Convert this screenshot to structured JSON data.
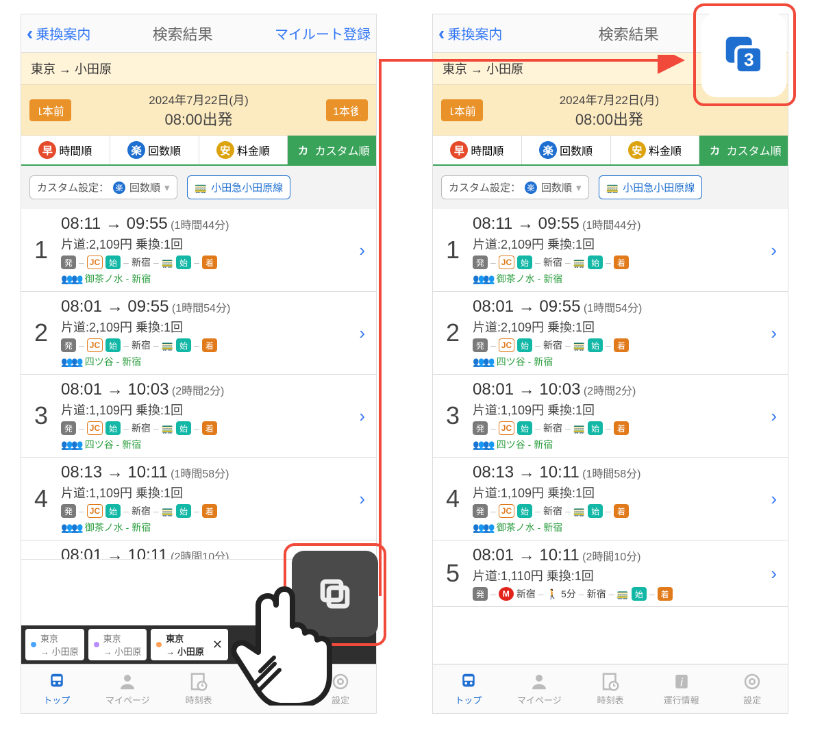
{
  "nav": {
    "back": "乗換案内",
    "title": "検索結果",
    "right": "マイルート登録"
  },
  "stations": "東京 → 小田原",
  "date": {
    "line1": "2024年7月22日(月)",
    "line2": "08:00出発",
    "prev": "1本前",
    "next": "1本後"
  },
  "sort": {
    "hayai": "時間順",
    "raku": "回数順",
    "yasui": "料金順",
    "custom": "カスタム順",
    "icon_hayai": "早",
    "icon_raku": "楽",
    "icon_yasui": "安",
    "icon_custom": "カ"
  },
  "filter": {
    "label": "カスタム設定：",
    "value": "回数順",
    "route": "小田急小田原線"
  },
  "seg": {
    "dep": "発",
    "jc": "JC",
    "start": "始",
    "station1": "新宿",
    "arr": "着",
    "walk": "5分"
  },
  "results": [
    {
      "n": "1",
      "t1": "08:11",
      "t2": "09:55",
      "dur": "(1時間44分)",
      "fare": "片道:2,109円 乗換:1回",
      "crowd": "御茶ノ水 - 新宿"
    },
    {
      "n": "2",
      "t1": "08:01",
      "t2": "09:55",
      "dur": "(1時間54分)",
      "fare": "片道:2,109円 乗換:1回",
      "crowd": "四ツ谷 - 新宿"
    },
    {
      "n": "3",
      "t1": "08:01",
      "t2": "10:03",
      "dur": "(2時間2分)",
      "fare": "片道:1,109円 乗換:1回",
      "crowd": "四ツ谷 - 新宿"
    },
    {
      "n": "4",
      "t1": "08:13",
      "t2": "10:11",
      "dur": "(1時間58分)",
      "fare": "片道:1,109円 乗換:1回",
      "crowd": "御茶ノ水 - 新宿"
    },
    {
      "n": "5",
      "t1": "08:01",
      "t2": "10:11",
      "dur": "(2時間10分)",
      "fare": "片道:1,110円 乗換:1回",
      "crowd": ""
    }
  ],
  "history": [
    {
      "from": "東京",
      "to": "→ 小田原",
      "color": "#4aa3ff"
    },
    {
      "from": "東京",
      "to": "→ 小田原",
      "color": "#b88bff"
    },
    {
      "from": "東京",
      "to": "→ 小田原",
      "color": "#ff9e55"
    }
  ],
  "tabs": {
    "top": "トップ",
    "mypage": "マイページ",
    "timetable": "時刻表",
    "info": "運行情報",
    "settings": "設定"
  },
  "overlay_badge": "3"
}
